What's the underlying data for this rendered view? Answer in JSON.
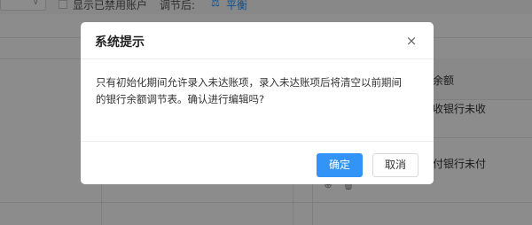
{
  "background": {
    "toolbar": {
      "show_disabled_accounts_label": "显示已禁用账户",
      "adjust_after_label": "调节后:",
      "balance_status": "平衡"
    },
    "table": {
      "header_right_label": "余额",
      "row1_label": "收银行未收",
      "row2_label": "付银行未付"
    }
  },
  "dialog": {
    "title": "系统提示",
    "close_symbol": "×",
    "message_line1": "只有初始化期间允许录入未达账项，录入未达账项后将清空以前期间",
    "message_line2": "的银行余额调节表。确认进行编辑吗?",
    "confirm_label": "确定",
    "cancel_label": "取消"
  }
}
